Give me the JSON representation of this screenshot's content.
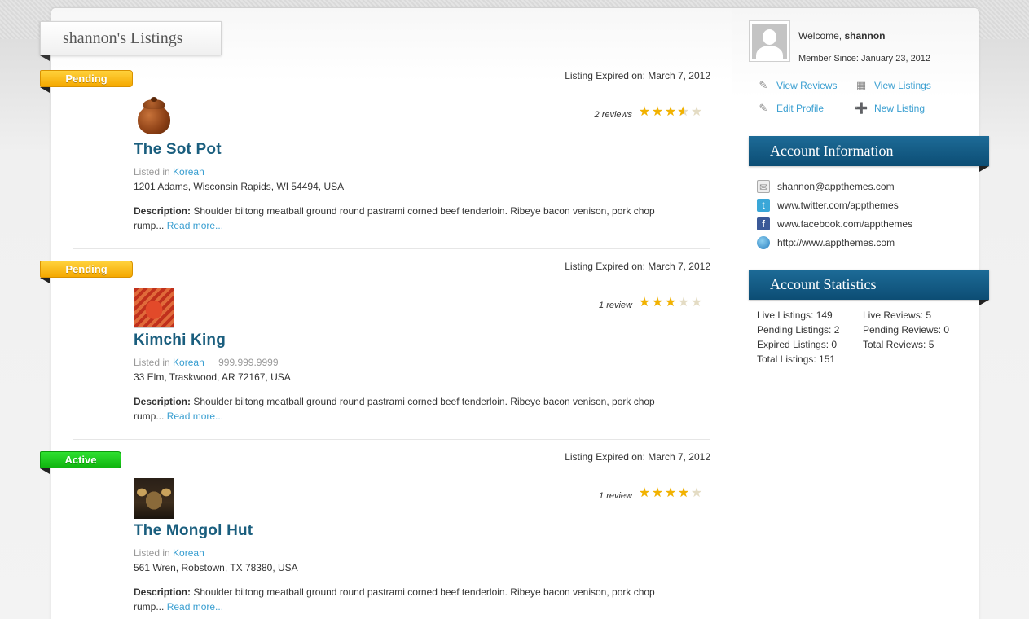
{
  "page_title": "shannon's Listings",
  "listings": [
    {
      "status": "Pending",
      "expired": "Listing Expired on: March 7, 2012",
      "reviews": "2 reviews",
      "rating": 3.5,
      "title": "The Sot Pot",
      "listed_in_label": "Listed in",
      "category": "Korean",
      "phone": "",
      "address": "1201 Adams, Wisconsin Rapids, WI 54494, USA",
      "desc_label": "Description:",
      "desc": "Shoulder biltong meatball ground round pastrami corned beef tenderloin. Ribeye bacon venison, pork chop rump...",
      "read_more": "Read more..."
    },
    {
      "status": "Pending",
      "expired": "Listing Expired on: March 7, 2012",
      "reviews": "1 review",
      "rating": 3,
      "title": "Kimchi King",
      "listed_in_label": "Listed in",
      "category": "Korean",
      "phone": "999.999.9999",
      "address": "33 Elm, Traskwood, AR 72167, USA",
      "desc_label": "Description:",
      "desc": "Shoulder biltong meatball ground round pastrami corned beef tenderloin. Ribeye bacon venison, pork chop rump...",
      "read_more": "Read more..."
    },
    {
      "status": "Active",
      "expired": "Listing Expired on: March 7, 2012",
      "reviews": "1 review",
      "rating": 4,
      "title": "The Mongol Hut",
      "listed_in_label": "Listed in",
      "category": "Korean",
      "phone": "",
      "address": "561 Wren, Robstown, TX 78380, USA",
      "desc_label": "Description:",
      "desc": "Shoulder biltong meatball ground round pastrami corned beef tenderloin. Ribeye bacon venison, pork chop rump...",
      "read_more": "Read more..."
    }
  ],
  "sidebar": {
    "welcome_label": "Welcome,",
    "username": "shannon",
    "member_since": "Member Since: January 23, 2012",
    "links": {
      "view_reviews": "View Reviews",
      "view_listings": "View Listings",
      "edit_profile": "Edit Profile",
      "new_listing": "New Listing"
    },
    "account_info": {
      "heading": "Account Information",
      "email": "shannon@appthemes.com",
      "twitter": "www.twitter.com/appthemes",
      "facebook": "www.facebook.com/appthemes",
      "website": "http://www.appthemes.com"
    },
    "account_stats": {
      "heading": "Account Statistics",
      "live_listings": "Live Listings: 149",
      "pending_listings": "Pending Listings: 2",
      "expired_listings": "Expired Listings: 0",
      "total_listings": "Total Listings: 151",
      "live_reviews": "Live Reviews: 5",
      "pending_reviews": "Pending Reviews: 0",
      "total_reviews": "Total Reviews: 5"
    }
  },
  "colors": {
    "pending": "#f5a800",
    "active": "#10b50f",
    "title_link": "#1a5e7e",
    "link": "#3a9fd1",
    "panel_head": "#0c4d74"
  }
}
